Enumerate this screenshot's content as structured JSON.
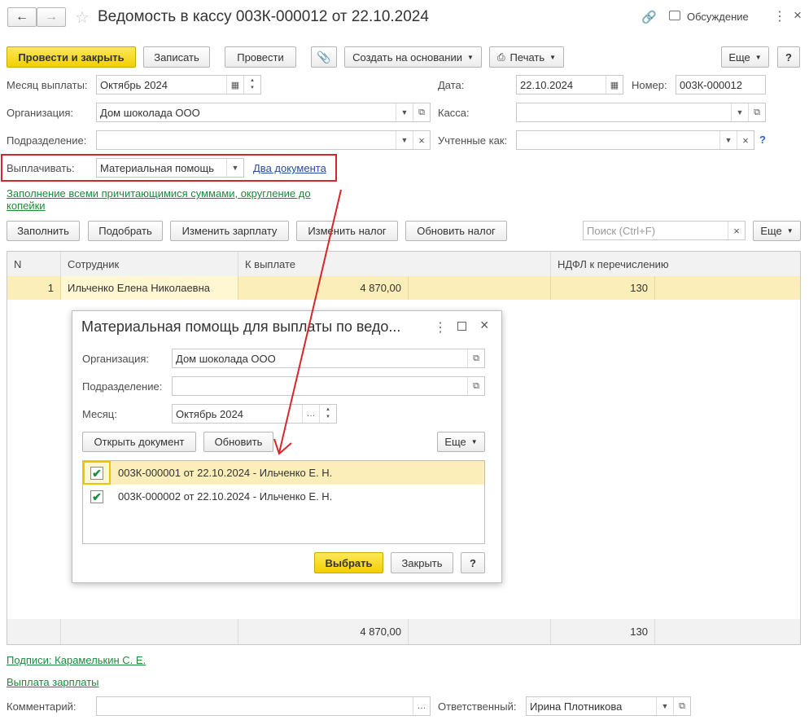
{
  "title": "Ведомость в кассу 003К-000012 от 22.10.2024",
  "header": {
    "discussion": "Обсуждение"
  },
  "toolbar": {
    "post_close": "Провести и закрыть",
    "save": "Записать",
    "post": "Провести",
    "create_based": "Создать на основании",
    "print": "Печать",
    "more": "Еще",
    "help": "?"
  },
  "form": {
    "month_label": "Месяц выплаты:",
    "month_value": "Октябрь 2024",
    "date_label": "Дата:",
    "date_value": "22.10.2024",
    "number_label": "Номер:",
    "number_value": "003К-000012",
    "org_label": "Организация:",
    "org_value": "Дом шоколада ООО",
    "kassa_label": "Касса:",
    "kassa_value": "",
    "division_label": "Подразделение:",
    "division_value": "",
    "accounted_label": "Учтенные как:",
    "accounted_value": "",
    "question": "?",
    "pay_label": "Выплачивать:",
    "pay_value": "Материальная помощь",
    "pay_link": "Два документа",
    "fill_link": "Заполнение всеми причитающимися суммами, округление до копейки"
  },
  "table_toolbar": {
    "fill": "Заполнить",
    "pick": "Подобрать",
    "change_salary": "Изменить зарплату",
    "change_tax": "Изменить налог",
    "update_tax": "Обновить налог",
    "search_placeholder": "Поиск (Ctrl+F)",
    "more": "Еще"
  },
  "table": {
    "columns": [
      "N",
      "Сотрудник",
      "К выплате",
      "НДФЛ к перечислению"
    ],
    "rows": [
      {
        "n": "1",
        "employee": "Ильченко Елена Николаевна",
        "amount": "4 870,00",
        "tax": "130"
      }
    ],
    "totals": {
      "amount": "4 870,00",
      "tax": "130"
    }
  },
  "footer": {
    "signatures": "Подписи: Карамелькин С. Е.",
    "payment": "Выплата зарплаты",
    "comment_label": "Комментарий:",
    "comment_value": "",
    "responsible_label": "Ответственный:",
    "responsible_value": "Ирина Плотникова"
  },
  "dialog": {
    "title": "Материальная помощь для выплаты по ведо...",
    "org_label": "Организация:",
    "org_value": "Дом шоколада ООО",
    "division_label": "Подразделение:",
    "division_value": "",
    "month_label": "Месяц:",
    "month_value": "Октябрь 2024",
    "open_doc": "Открыть документ",
    "refresh": "Обновить",
    "more": "Еще",
    "items": [
      {
        "text": "003К-000001 от 22.10.2024 - Ильченко Е. Н.",
        "checked": true
      },
      {
        "text": "003К-000002 от 22.10.2024 - Ильченко Е. Н.",
        "checked": true
      }
    ],
    "select": "Выбрать",
    "close": "Закрыть",
    "help": "?"
  },
  "colors": {
    "accent_yellow": "#f5d400",
    "highlight_red": "#d6262b",
    "link_green": "#1c8a3a",
    "row_highlight": "#fbeeb8"
  }
}
